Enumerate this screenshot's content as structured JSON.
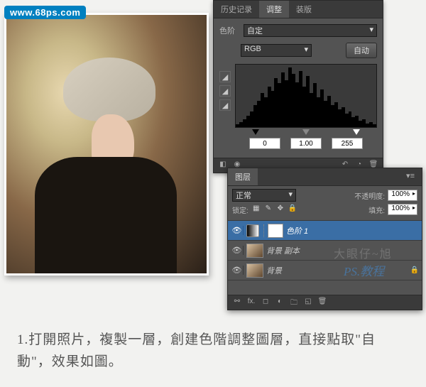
{
  "watermark": {
    "url": "www.68ps.com"
  },
  "adjustments_panel": {
    "tabs": {
      "history": "历史记录",
      "adjustments": "调整",
      "mask": "装版"
    },
    "type_label": "色阶",
    "preset": "自定",
    "channel": "RGB",
    "auto_label": "自动",
    "levels": {
      "black": "0",
      "mid": "1.00",
      "white": "255"
    }
  },
  "layers_panel": {
    "tab": "图层",
    "blend_mode": "正常",
    "opacity_label": "不透明度:",
    "opacity_value": "100%",
    "lock_label": "锁定:",
    "fill_label": "填充:",
    "fill_value": "100%",
    "layers": [
      {
        "name": "色阶 1"
      },
      {
        "name": "背景 副本"
      },
      {
        "name": "背景"
      }
    ]
  },
  "overlay": {
    "text1": "大眼仔~旭",
    "text2": "PS.教程"
  },
  "instructions": "1.打開照片，複製一層，創建色階調整圖層，直接點取\"自動\"，效果如圖。"
}
